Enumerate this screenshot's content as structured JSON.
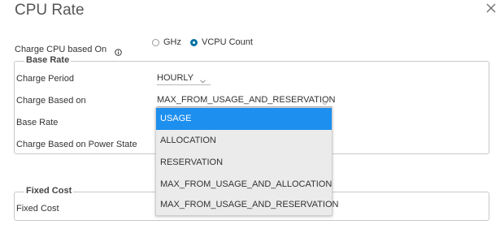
{
  "dialog": {
    "title": "CPU Rate"
  },
  "charge_cpu": {
    "label": "Charge CPU based On",
    "options": [
      {
        "label": "GHz",
        "checked": false
      },
      {
        "label": "VCPU Count",
        "checked": true
      }
    ]
  },
  "base_rate": {
    "legend": "Base Rate",
    "charge_period_label": "Charge Period",
    "charge_period_value": "HOURLY",
    "charge_based_on_label": "Charge Based on",
    "charge_based_on_value": "MAX_FROM_USAGE_AND_RESERVATION",
    "base_rate_label": "Base Rate",
    "power_state_label": "Charge Based on Power State"
  },
  "dropdown": {
    "options": [
      "USAGE",
      "ALLOCATION",
      "RESERVATION",
      "MAX_FROM_USAGE_AND_ALLOCATION",
      "MAX_FROM_USAGE_AND_RESERVATION"
    ],
    "selected_index": 0
  },
  "fixed_cost": {
    "legend": "Fixed Cost",
    "label": "Fixed Cost"
  },
  "colors": {
    "accent": "#0072a3",
    "dropdown_highlight": "#1d8fef",
    "dropdown_bg": "#ebebeb"
  }
}
